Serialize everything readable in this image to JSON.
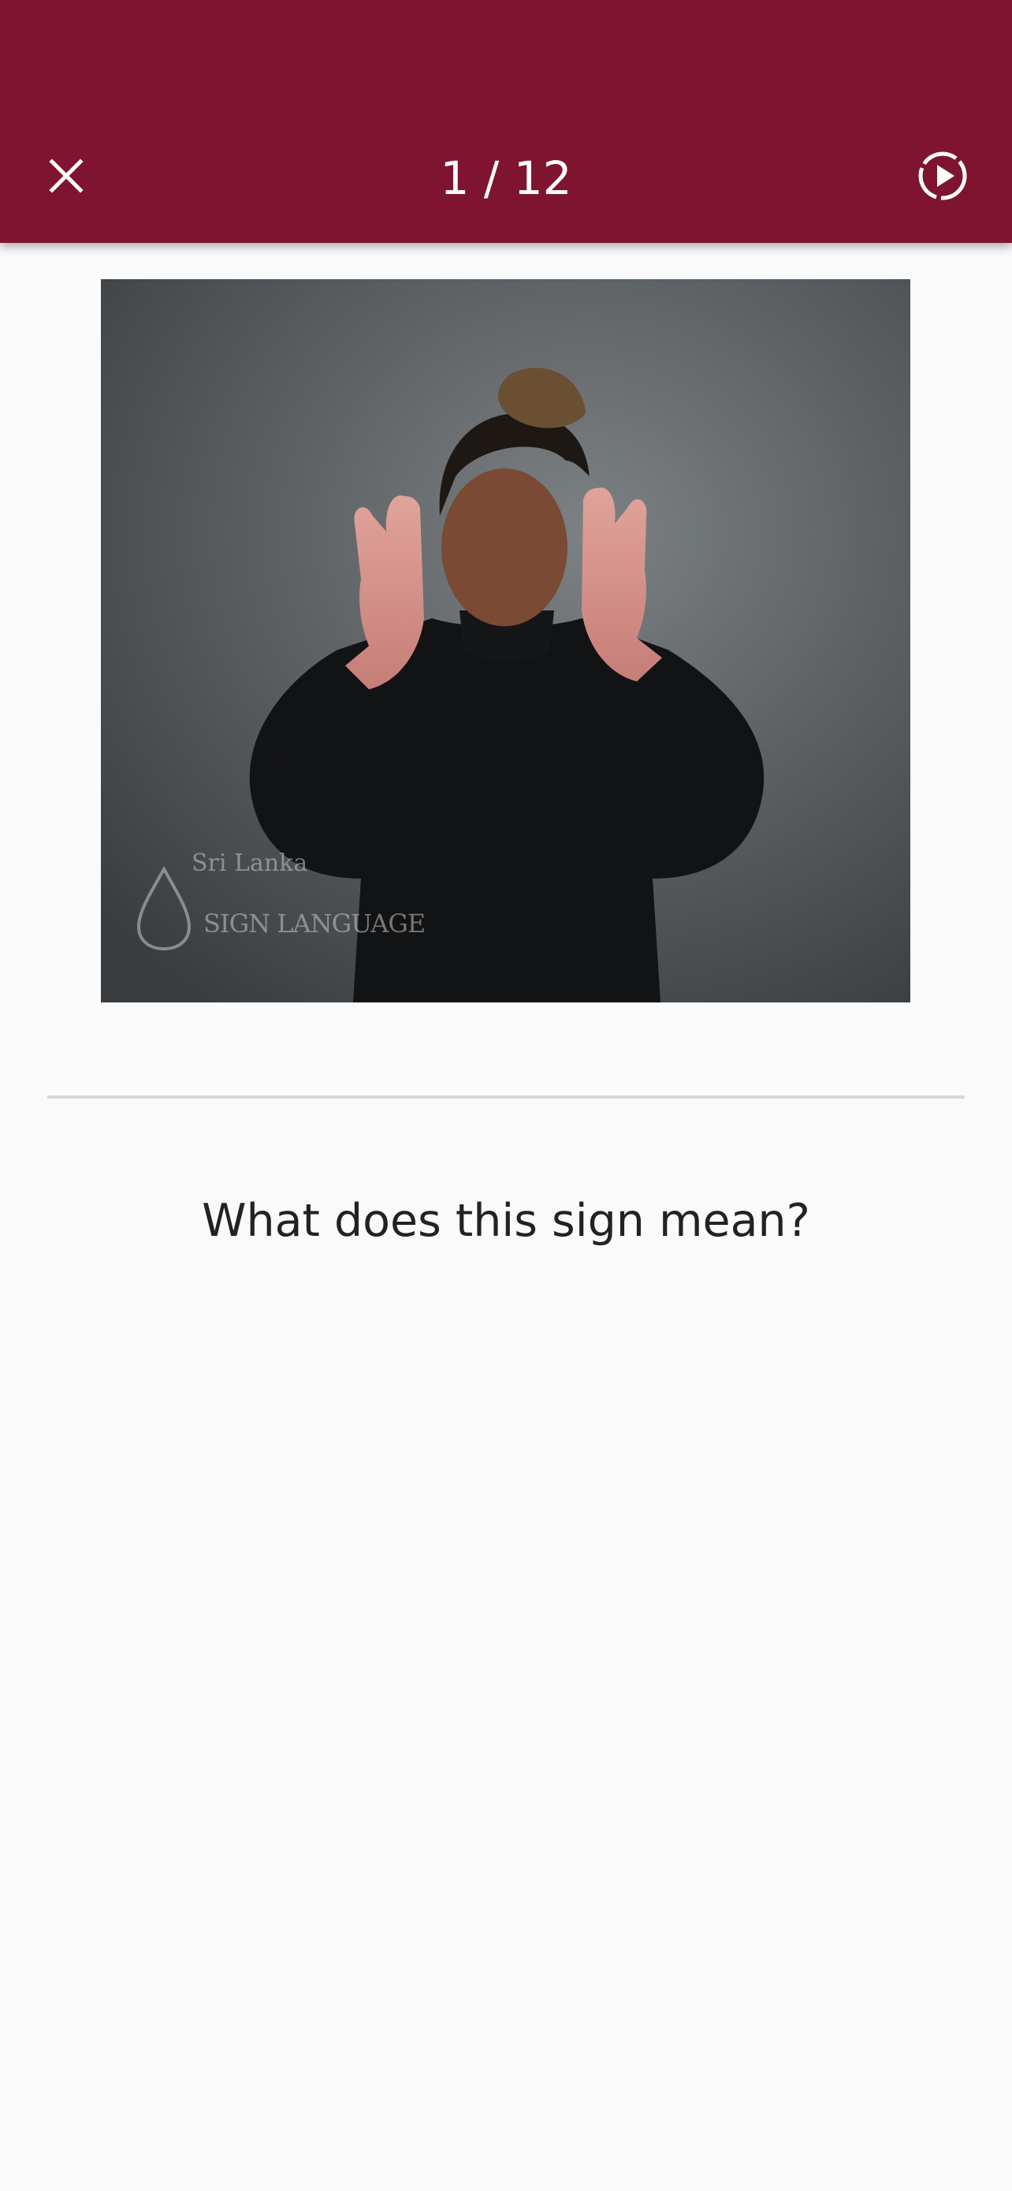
{
  "header": {
    "counter": "1 / 12",
    "close_icon": "close-icon",
    "play_icon": "play-circle-dashed-icon",
    "background_color": "#7f1431"
  },
  "media": {
    "watermark_line1": "Sri Lanka",
    "watermark_line2": "SIGN LANGUAGE"
  },
  "quiz": {
    "question": "What does this sign mean?"
  }
}
